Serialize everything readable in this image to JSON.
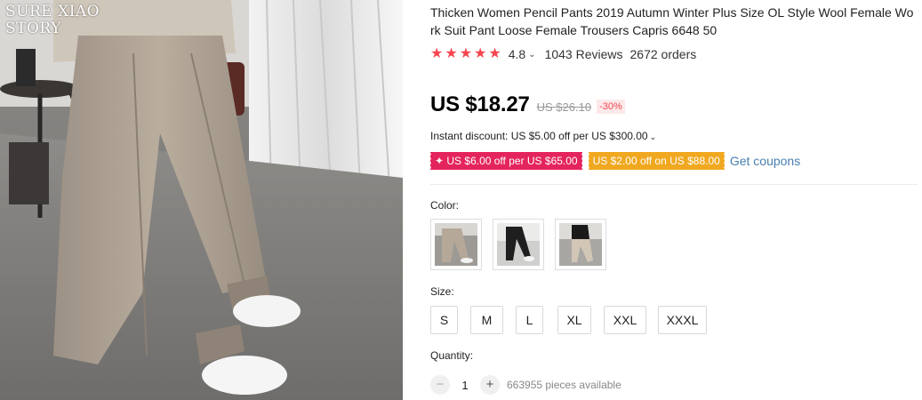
{
  "photo": {
    "watermark_line1": "SURE XIAO",
    "watermark_line2": "STORY"
  },
  "product": {
    "title": "Thicken Women Pencil Pants 2019 Autumn Winter Plus Size OL Style Wool Female Work Suit Pant Loose Female Trousers Capris 6648 50",
    "rating": "4.8",
    "stars": 5,
    "reviews": "1043 Reviews",
    "orders": "2672 orders"
  },
  "price": {
    "current": "US $18.27",
    "original": "US $26.10",
    "discount": "-30%"
  },
  "instant_discount": "Instant discount: US $5.00 off per US $300.00",
  "coupons": {
    "pink": "✦ US $6.00 off per US $65.00",
    "orange": "US $2.00 off on US $88.00",
    "link": "Get coupons"
  },
  "color": {
    "label": "Color:",
    "options": [
      "khaki",
      "black",
      "khaki-with-black-top"
    ]
  },
  "size": {
    "label": "Size:",
    "options": [
      "S",
      "M",
      "L",
      "XL",
      "XXL",
      "XXXL"
    ]
  },
  "quantity": {
    "label": "Quantity:",
    "minus": "−",
    "value": "1",
    "plus": "+",
    "available": "663955 pieces available"
  },
  "colors": {
    "star": "#f5464f",
    "coupon_pink": "#e4245d",
    "coupon_orange": "#f0a820",
    "link": "#4a7fb0"
  }
}
